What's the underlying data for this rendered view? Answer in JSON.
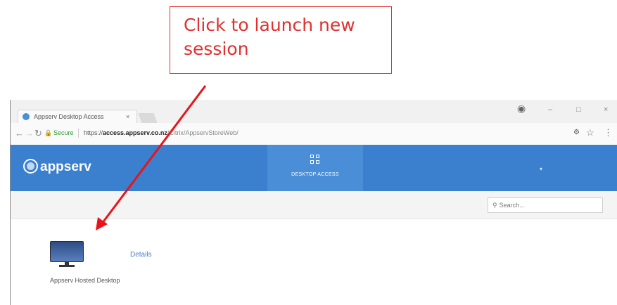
{
  "callout": {
    "line1": "Click to launch new",
    "line2": "session",
    "color": "#e0302f"
  },
  "browser": {
    "tab_title": "Appserv Desktop Access",
    "tab_close": "×",
    "window_controls": [
      "–",
      "□",
      "×"
    ],
    "address": {
      "secure_label": "Secure",
      "url_prefix": "https://",
      "url_host": "access.appserv.co.nz",
      "url_path": "/Citrix/AppservStoreWeb/"
    }
  },
  "app": {
    "logo_text": "appserv",
    "nav_tab_label": "DESKTOP ACCESS",
    "user_label": "",
    "search_placeholder": "Search...",
    "brand_color": "#3b7fcf"
  },
  "desktop_item": {
    "name": "Appserv Hosted Desktop",
    "details_label": "Details"
  },
  "icons": [
    "favicon",
    "back-icon",
    "forward-icon",
    "reload-icon",
    "lock-icon",
    "key-icon",
    "star-icon",
    "menu-icon",
    "profile-icon",
    "grid-icon",
    "search-icon",
    "monitor-icon",
    "arrow"
  ]
}
